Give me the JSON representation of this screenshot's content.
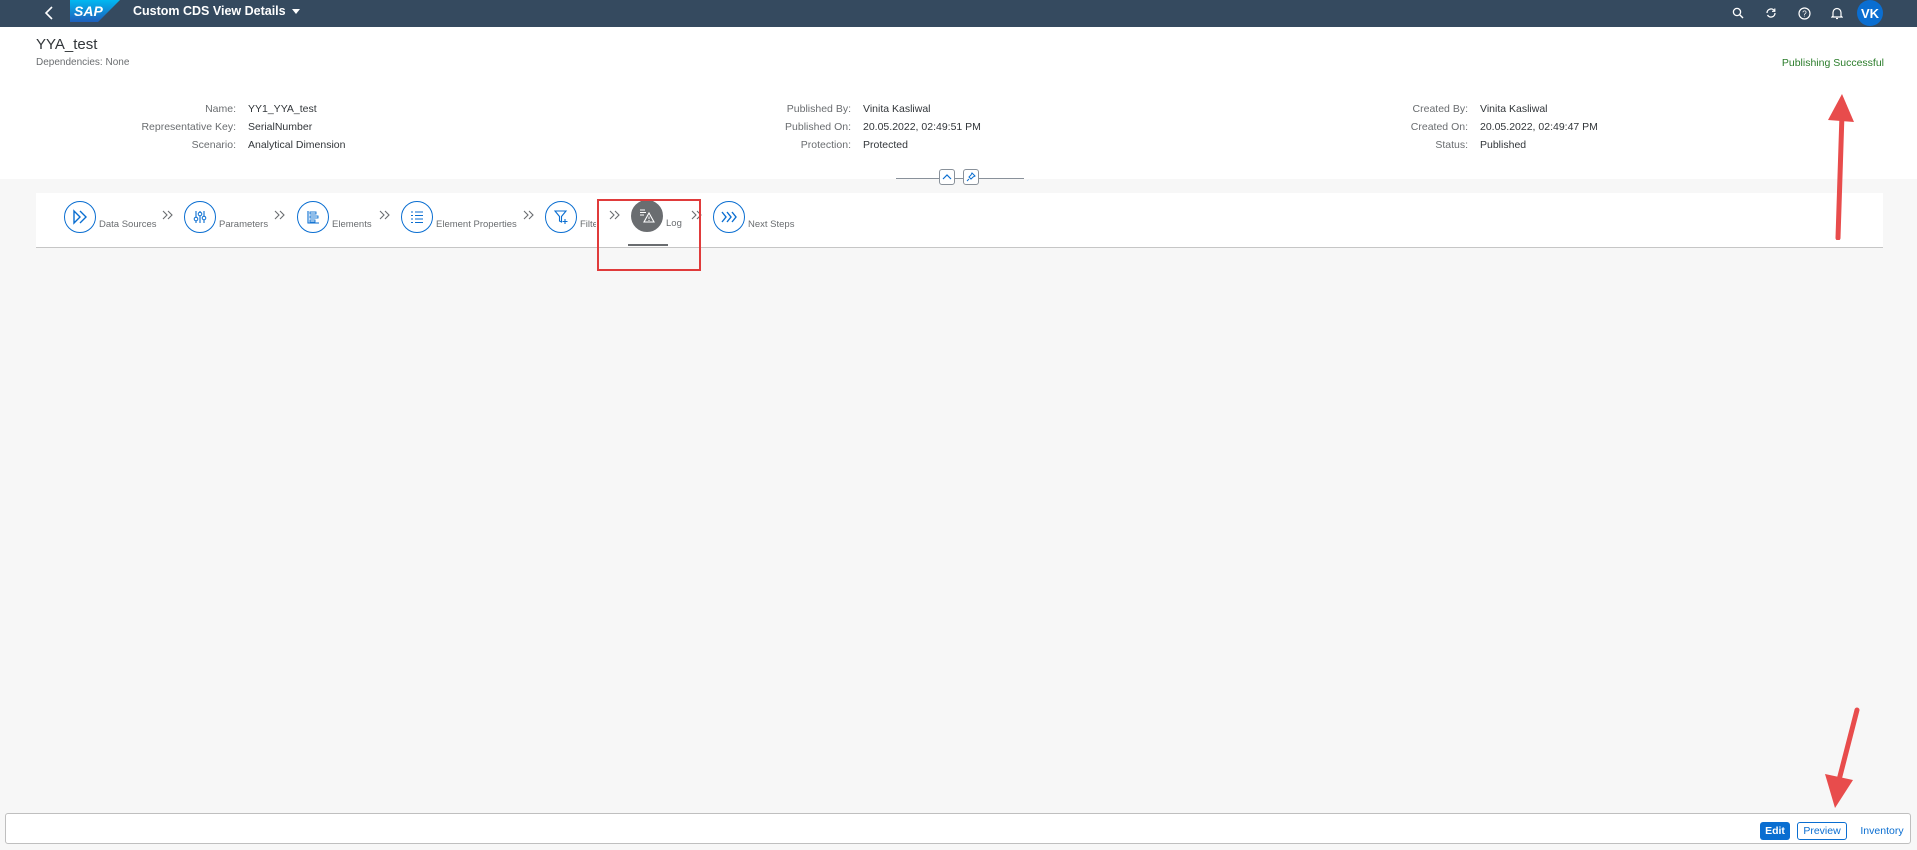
{
  "shell": {
    "logo_text": "SAP",
    "app_title": "Custom CDS View Details",
    "avatar_initials": "VK",
    "icons": [
      "back-icon",
      "search-icon",
      "sync-icon",
      "help-icon",
      "notification-icon"
    ]
  },
  "header": {
    "title": "YYA_test",
    "subtitle": "Dependencies: None",
    "status_message": "Publishing Successful",
    "col1": [
      {
        "label": "Name:",
        "value": "YY1_YYA_test"
      },
      {
        "label": "Representative Key:",
        "value": "SerialNumber"
      },
      {
        "label": "Scenario:",
        "value": "Analytical Dimension"
      }
    ],
    "col2": [
      {
        "label": "Published By:",
        "value": "Vinita Kasliwal"
      },
      {
        "label": "Published On:",
        "value": "20.05.2022, 02:49:51 PM"
      },
      {
        "label": "Protection:",
        "value": "Protected"
      }
    ],
    "col3": [
      {
        "label": "Created By:",
        "value": "Vinita Kasliwal"
      },
      {
        "label": "Created On:",
        "value": "20.05.2022, 02:49:47 PM"
      },
      {
        "label": "Status:",
        "value": "Published"
      }
    ]
  },
  "steps": [
    {
      "label": "Data Sources",
      "icon": "data-sources-icon"
    },
    {
      "label": "Parameters",
      "icon": "parameters-icon"
    },
    {
      "label": "Elements",
      "icon": "elements-icon"
    },
    {
      "label": "Element Properties",
      "icon": "element-properties-icon"
    },
    {
      "label": "Filter",
      "icon": "filter-icon"
    },
    {
      "label": "Log",
      "icon": "log-warning-icon",
      "active": true
    },
    {
      "label": "Next Steps",
      "icon": "next-steps-icon"
    }
  ],
  "footer": {
    "edit_label": "Edit",
    "preview_label": "Preview",
    "inventory_label": "Inventory"
  },
  "colors": {
    "shell_bg": "#354a5f",
    "brand_blue": "#0a6ed1",
    "success_green": "#2b7d2b",
    "annotation_red": "#e03b3b"
  }
}
